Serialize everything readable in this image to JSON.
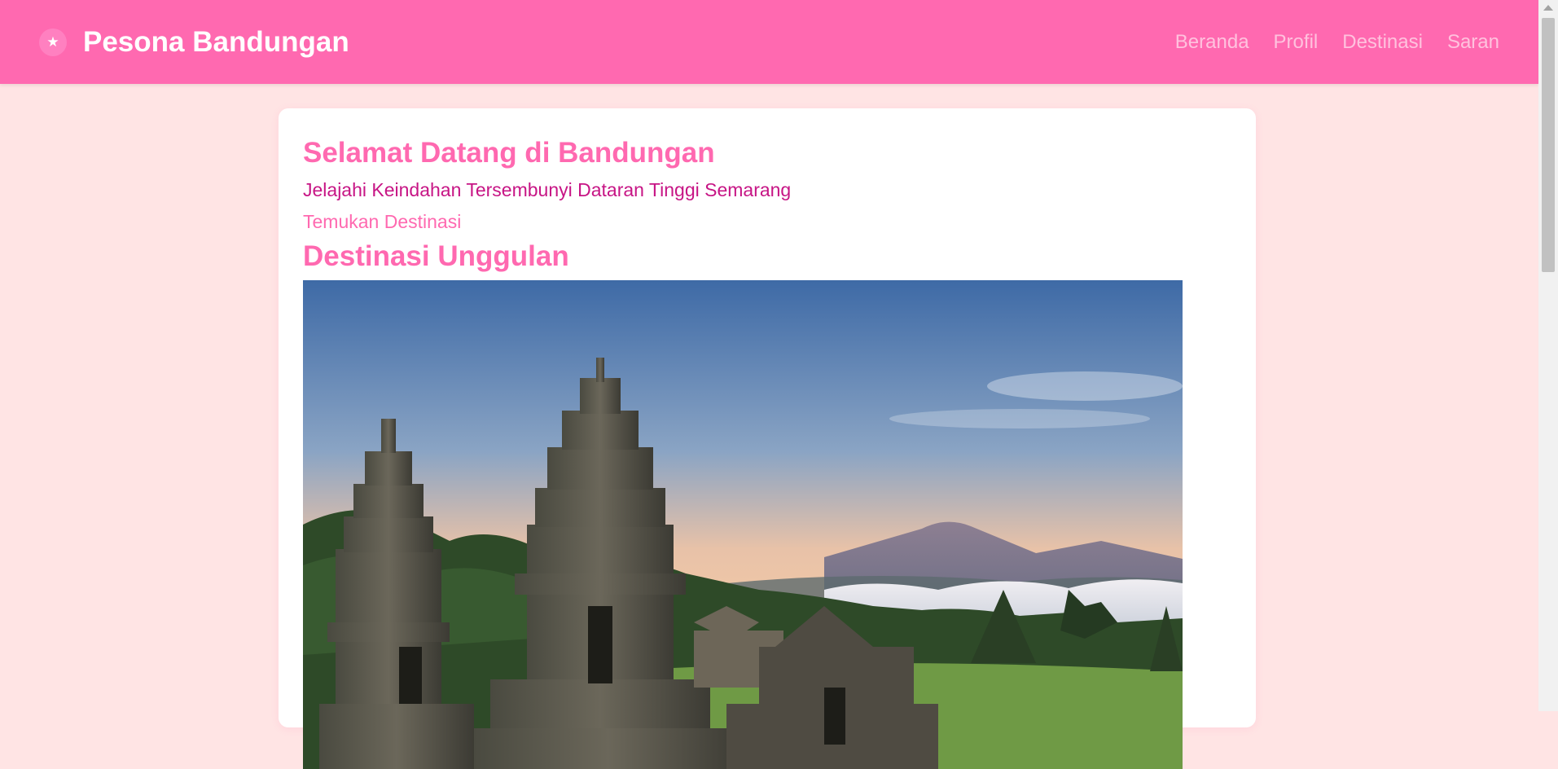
{
  "header": {
    "logo_glyph": "★",
    "brand": "Pesona Bandungan",
    "nav": [
      {
        "label": "Beranda"
      },
      {
        "label": "Profil"
      },
      {
        "label": "Destinasi"
      },
      {
        "label": "Saran"
      }
    ]
  },
  "hero": {
    "title": "Selamat Datang di Bandungan",
    "subtitle": "Jelajahi Keindahan Tersembunyi Dataran Tinggi Semarang",
    "cta": "Temukan Destinasi"
  },
  "featured": {
    "title": "Destinasi Unggulan"
  },
  "colors": {
    "accent": "#ff69b0",
    "page_background": "#ffe4e4",
    "subtitle": "#c71585",
    "nav_link": "#ffc2de"
  }
}
